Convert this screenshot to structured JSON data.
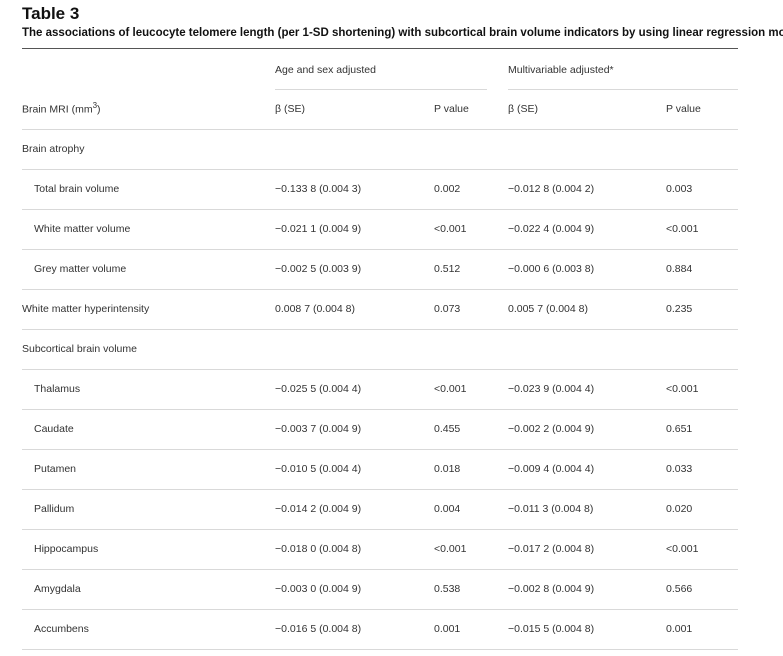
{
  "table": {
    "title": "Table 3",
    "caption": "The associations of leucocyte telomere length (per 1-SD shortening) with subcortical brain volume indicators by using linear regression models",
    "group_headers": {
      "age_sex": "Age and sex adjusted",
      "multivariable": "Multivariable adjusted*"
    },
    "column_headers": {
      "row_label": "Brain MRI (mm",
      "row_label_sup": "3",
      "row_label_close": ")",
      "beta1": "β (SE)",
      "p1": "P value",
      "beta2": "β (SE)",
      "p2": "P value"
    },
    "rows": [
      {
        "label": "Brain atrophy",
        "indent": false,
        "b1": "",
        "p1": "",
        "b2": "",
        "p2": ""
      },
      {
        "label": "Total brain volume",
        "indent": true,
        "b1": "−0.133 8 (0.004 3)",
        "p1": "0.002",
        "b2": "−0.012 8 (0.004 2)",
        "p2": "0.003"
      },
      {
        "label": "White matter volume",
        "indent": true,
        "b1": "−0.021 1 (0.004 9)",
        "p1": "<0.001",
        "b2": "−0.022 4 (0.004 9)",
        "p2": "<0.001"
      },
      {
        "label": "Grey matter volume",
        "indent": true,
        "b1": "−0.002 5 (0.003 9)",
        "p1": "0.512",
        "b2": "−0.000 6 (0.003 8)",
        "p2": "0.884"
      },
      {
        "label": "White matter hyperintensity",
        "indent": false,
        "b1": "0.008 7 (0.004 8)",
        "p1": "0.073",
        "b2": "0.005 7 (0.004 8)",
        "p2": "0.235"
      },
      {
        "label": "Subcortical brain volume",
        "indent": false,
        "b1": "",
        "p1": "",
        "b2": "",
        "p2": ""
      },
      {
        "label": "Thalamus",
        "indent": true,
        "b1": "−0.025 5 (0.004 4)",
        "p1": "<0.001",
        "b2": "−0.023 9 (0.004 4)",
        "p2": "<0.001"
      },
      {
        "label": "Caudate",
        "indent": true,
        "b1": "−0.003 7 (0.004 9)",
        "p1": "0.455",
        "b2": "−0.002 2 (0.004 9)",
        "p2": "0.651"
      },
      {
        "label": "Putamen",
        "indent": true,
        "b1": "−0.010 5 (0.004 4)",
        "p1": "0.018",
        "b2": "−0.009 4 (0.004 4)",
        "p2": "0.033"
      },
      {
        "label": "Pallidum",
        "indent": true,
        "b1": "−0.014 2 (0.004 9)",
        "p1": "0.004",
        "b2": "−0.011 3 (0.004 8)",
        "p2": "0.020"
      },
      {
        "label": "Hippocampus",
        "indent": true,
        "b1": "−0.018 0 (0.004 8)",
        "p1": "<0.001",
        "b2": "−0.017 2 (0.004 8)",
        "p2": "<0.001"
      },
      {
        "label": "Amygdala",
        "indent": true,
        "b1": "−0.003 0 (0.004 9)",
        "p1": "0.538",
        "b2": "−0.002 8 (0.004 9)",
        "p2": "0.566"
      },
      {
        "label": "Accumbens",
        "indent": true,
        "b1": "−0.016 5 (0.004 8)",
        "p1": "0.001",
        "b2": "−0.015 5 (0.004 8)",
        "p2": "0.001"
      }
    ]
  }
}
